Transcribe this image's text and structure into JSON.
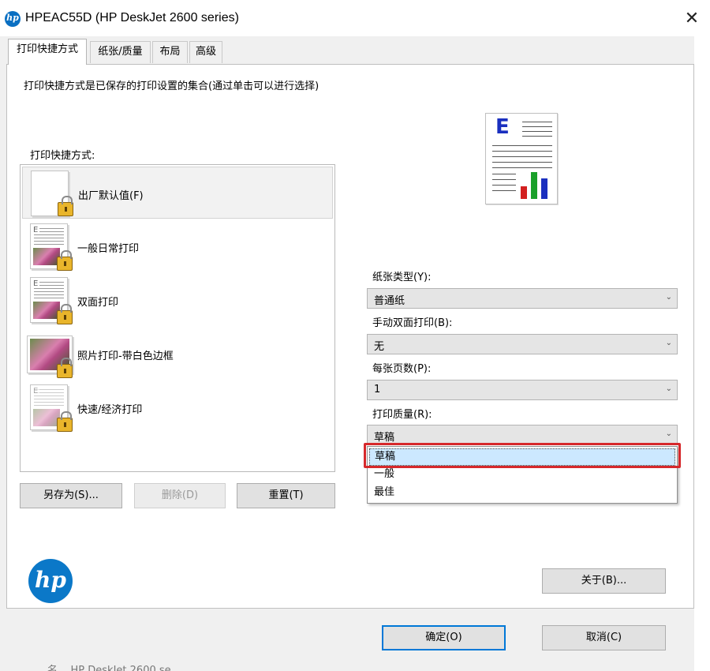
{
  "window": {
    "title": "HPEAC55D (HP DeskJet 2600 series)",
    "logo_text": "hp",
    "close_glyph": "✕"
  },
  "tabs": [
    {
      "label": "打印快捷方式",
      "active": true
    },
    {
      "label": "纸张/质量",
      "active": false
    },
    {
      "label": "布局",
      "active": false
    },
    {
      "label": "高级",
      "active": false
    }
  ],
  "description": "打印快捷方式是已保存的打印设置的集合(通过单击可以进行选择)",
  "shortcuts": {
    "label": "打印快捷方式:",
    "items": [
      {
        "label": "出厂默认值(F)",
        "icon": "blank-page-icon",
        "selected": true
      },
      {
        "label": "一般日常打印",
        "icon": "document-photo-icon",
        "selected": false
      },
      {
        "label": "双面打印",
        "icon": "two-sided-icon",
        "selected": false
      },
      {
        "label": "照片打印-带白色边框",
        "icon": "photo-border-icon",
        "selected": false
      },
      {
        "label": "快速/经济打印",
        "icon": "fast-economy-icon",
        "selected": false
      }
    ]
  },
  "buttons": {
    "save_as": "另存为(S)...",
    "delete": "删除(D)",
    "reset": "重置(T)",
    "about": "关于(B)...",
    "ok": "确定(O)",
    "cancel": "取消(C)"
  },
  "settings": {
    "paper_type": {
      "label": "纸张类型(Y):",
      "value": "普通纸"
    },
    "manual_duplex": {
      "label": "手动双面打印(B):",
      "value": "无"
    },
    "pages_per_sheet": {
      "label": "每张页数(P):",
      "value": "1"
    },
    "print_quality": {
      "label": "打印质量(R):",
      "value": "草稿",
      "options": [
        "草稿",
        "一般",
        "最佳"
      ],
      "highlighted": "草稿"
    }
  },
  "preview": {
    "letter": "E"
  },
  "brand": {
    "logo_text": "hp"
  },
  "background_text": "名...  HP DeskJet 2600 se...",
  "colors": {
    "accent": "#0078d7",
    "highlight_box": "#d6282b",
    "hp_blue": "#0b78c8"
  }
}
